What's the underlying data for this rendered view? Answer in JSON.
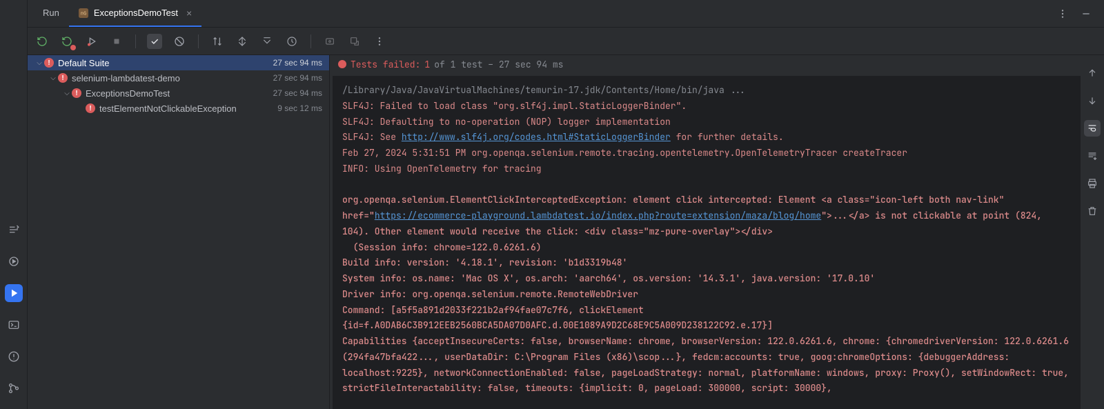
{
  "tabs": {
    "run_label": "Run",
    "test_tab_label": "ExceptionsDemoTest"
  },
  "test_status": {
    "fail_prefix": "Tests failed: ",
    "fail_count": "1",
    "suffix": " of 1 test – 27 sec 94 ms"
  },
  "tree": [
    {
      "label": "Default Suite",
      "time": "27 sec 94 ms",
      "indent": 0,
      "chev": true,
      "selected": true
    },
    {
      "label": "selenium-lambdatest-demo",
      "time": "27 sec 94 ms",
      "indent": 1,
      "chev": true
    },
    {
      "label": "ExceptionsDemoTest",
      "time": "27 sec 94 ms",
      "indent": 2,
      "chev": true
    },
    {
      "label": "testElementNotClickableException",
      "time": "9 sec 12 ms",
      "indent": 3,
      "chev": false
    }
  ],
  "console": {
    "cmd": "/Library/Java/JavaVirtualMachines/temurin-17.jdk/Contents/Home/bin/java ...",
    "l1": "SLF4J: Failed to load class \"org.slf4j.impl.StaticLoggerBinder\".",
    "l2": "SLF4J: Defaulting to no-operation (NOP) logger implementation",
    "l3a": "SLF4J: See ",
    "l3link": "http://www.slf4j.org/codes.html#StaticLoggerBinder",
    "l3b": " for further details.",
    "l4": "Feb 27, 2024 5:31:51 PM org.openqa.selenium.remote.tracing.opentelemetry.OpenTelemetryTracer createTracer",
    "l5": "INFO: Using OpenTelemetry for tracing",
    "e1": "org.openqa.selenium.ElementClickInterceptedException: element click intercepted: Element <a class=\"icon-left both nav-link\" href=\"",
    "e1link": "https://ecommerce-playground.lambdatest.io/index.php?route=extension/maza/blog/home",
    "e1b": "\">...</a> is not clickable at point (824, 104). Other element would receive the click: <div class=\"mz-pure-overlay\"></div>",
    "e2": "  (Session info: chrome=122.0.6261.6)",
    "e3": "Build info: version: '4.18.1', revision: 'b1d3319b48'",
    "e4": "System info: os.name: 'Mac OS X', os.arch: 'aarch64', os.version: '14.3.1', java.version: '17.0.10'",
    "e5": "Driver info: org.openqa.selenium.remote.RemoteWebDriver",
    "e6": "Command: [a5f5a891d2033f221b2af94fae07c7f6, clickElement {id=f.A0DAB6C3B912EEB2560BCA5DA07D0AFC.d.00E1089A9D2C68E9C5A009D238122C92.e.17}]",
    "e7": "Capabilities {acceptInsecureCerts: false, browserName: chrome, browserVersion: 122.0.6261.6, chrome: {chromedriverVersion: 122.0.6261.6 (294fa47bfa422..., userDataDir: C:\\Program Files (x86)\\scop...}, fedcm:accounts: true, goog:chromeOptions: {debuggerAddress: localhost:9225}, networkConnectionEnabled: false, pageLoadStrategy: normal, platformName: windows, proxy: Proxy(), setWindowRect: true, strictFileInteractability: false, timeouts: {implicit: 0, pageLoad: 300000, script: 30000},"
  }
}
